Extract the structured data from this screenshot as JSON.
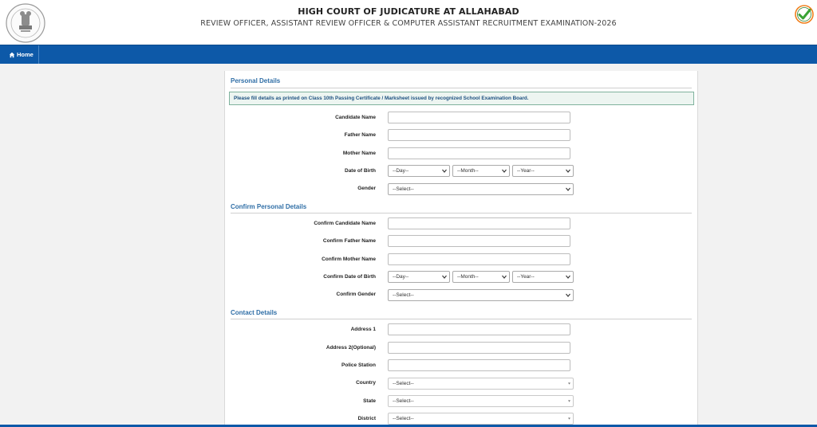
{
  "header": {
    "title": "HIGH COURT OF JUDICATURE AT ALLAHABAD",
    "subtitle": "REVIEW OFFICER, ASSISTANT REVIEW OFFICER & COMPUTER ASSISTANT RECRUITMENT EXAMINATION-2026"
  },
  "nav": {
    "home_label": "Home"
  },
  "colors": {
    "nav_blue": "#0d59a8",
    "section_title": "#2f6ea6",
    "notice_border": "#7fb29d",
    "check_green": "#3aa335",
    "badge_orange": "#f07e1b"
  },
  "personal": {
    "section_title": "Personal Details",
    "notice": "Please fill details as printed on Class 10th Passing Certificate / Marksheet issued by recognized School Examination Board.",
    "candidate_name_label": "Candidate Name",
    "candidate_name_value": "",
    "father_name_label": "Father Name",
    "father_name_value": "",
    "mother_name_label": "Mother Name",
    "mother_name_value": "",
    "dob_label": "Date of Birth",
    "dob_day": "--Day--",
    "dob_month": "--Month--",
    "dob_year": "--Year--",
    "gender_label": "Gender",
    "gender_value": "--Select--"
  },
  "confirm": {
    "section_title": "Confirm Personal Details",
    "candidate_name_label": "Confirm Candidate Name",
    "candidate_name_value": "",
    "father_name_label": "Confirm Father Name",
    "father_name_value": "",
    "mother_name_label": "Confirm Mother Name",
    "mother_name_value": "",
    "dob_label": "Confirm Date of Birth",
    "dob_day": "--Day--",
    "dob_month": "--Month--",
    "dob_year": "--Year--",
    "gender_label": "Confirm Gender",
    "gender_value": "--Select--"
  },
  "contact": {
    "section_title": "Contact Details",
    "address1_label": "Address 1",
    "address1_value": "",
    "address2_label": "Address 2(Optional)",
    "address2_value": "",
    "police_station_label": "Police Station",
    "police_station_value": "",
    "country_label": "Country",
    "country_value": "--Select--",
    "state_label": "State",
    "state_value": "--Select--",
    "district_label": "District",
    "district_value": "--Select--"
  }
}
